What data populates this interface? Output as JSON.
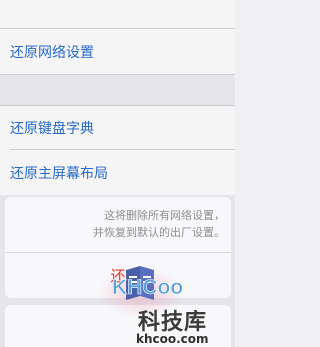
{
  "settings": {
    "items": [
      {
        "label": "还原网络设置"
      },
      {
        "label": "还原键盘字典"
      },
      {
        "label": "还原主屏幕布局"
      }
    ]
  },
  "action_sheet": {
    "message_line1": "这将删除所有网络设置，",
    "message_line2": "并恢复到默认的出厂设置。",
    "action_label": "还"
  },
  "watermark": {
    "logo_text": "KHCOO",
    "name": "科技库",
    "url": "khcoo.com"
  },
  "colors": {
    "link": "#2b6fd1",
    "destructive": "#e0332a",
    "background": "#efeff4"
  }
}
